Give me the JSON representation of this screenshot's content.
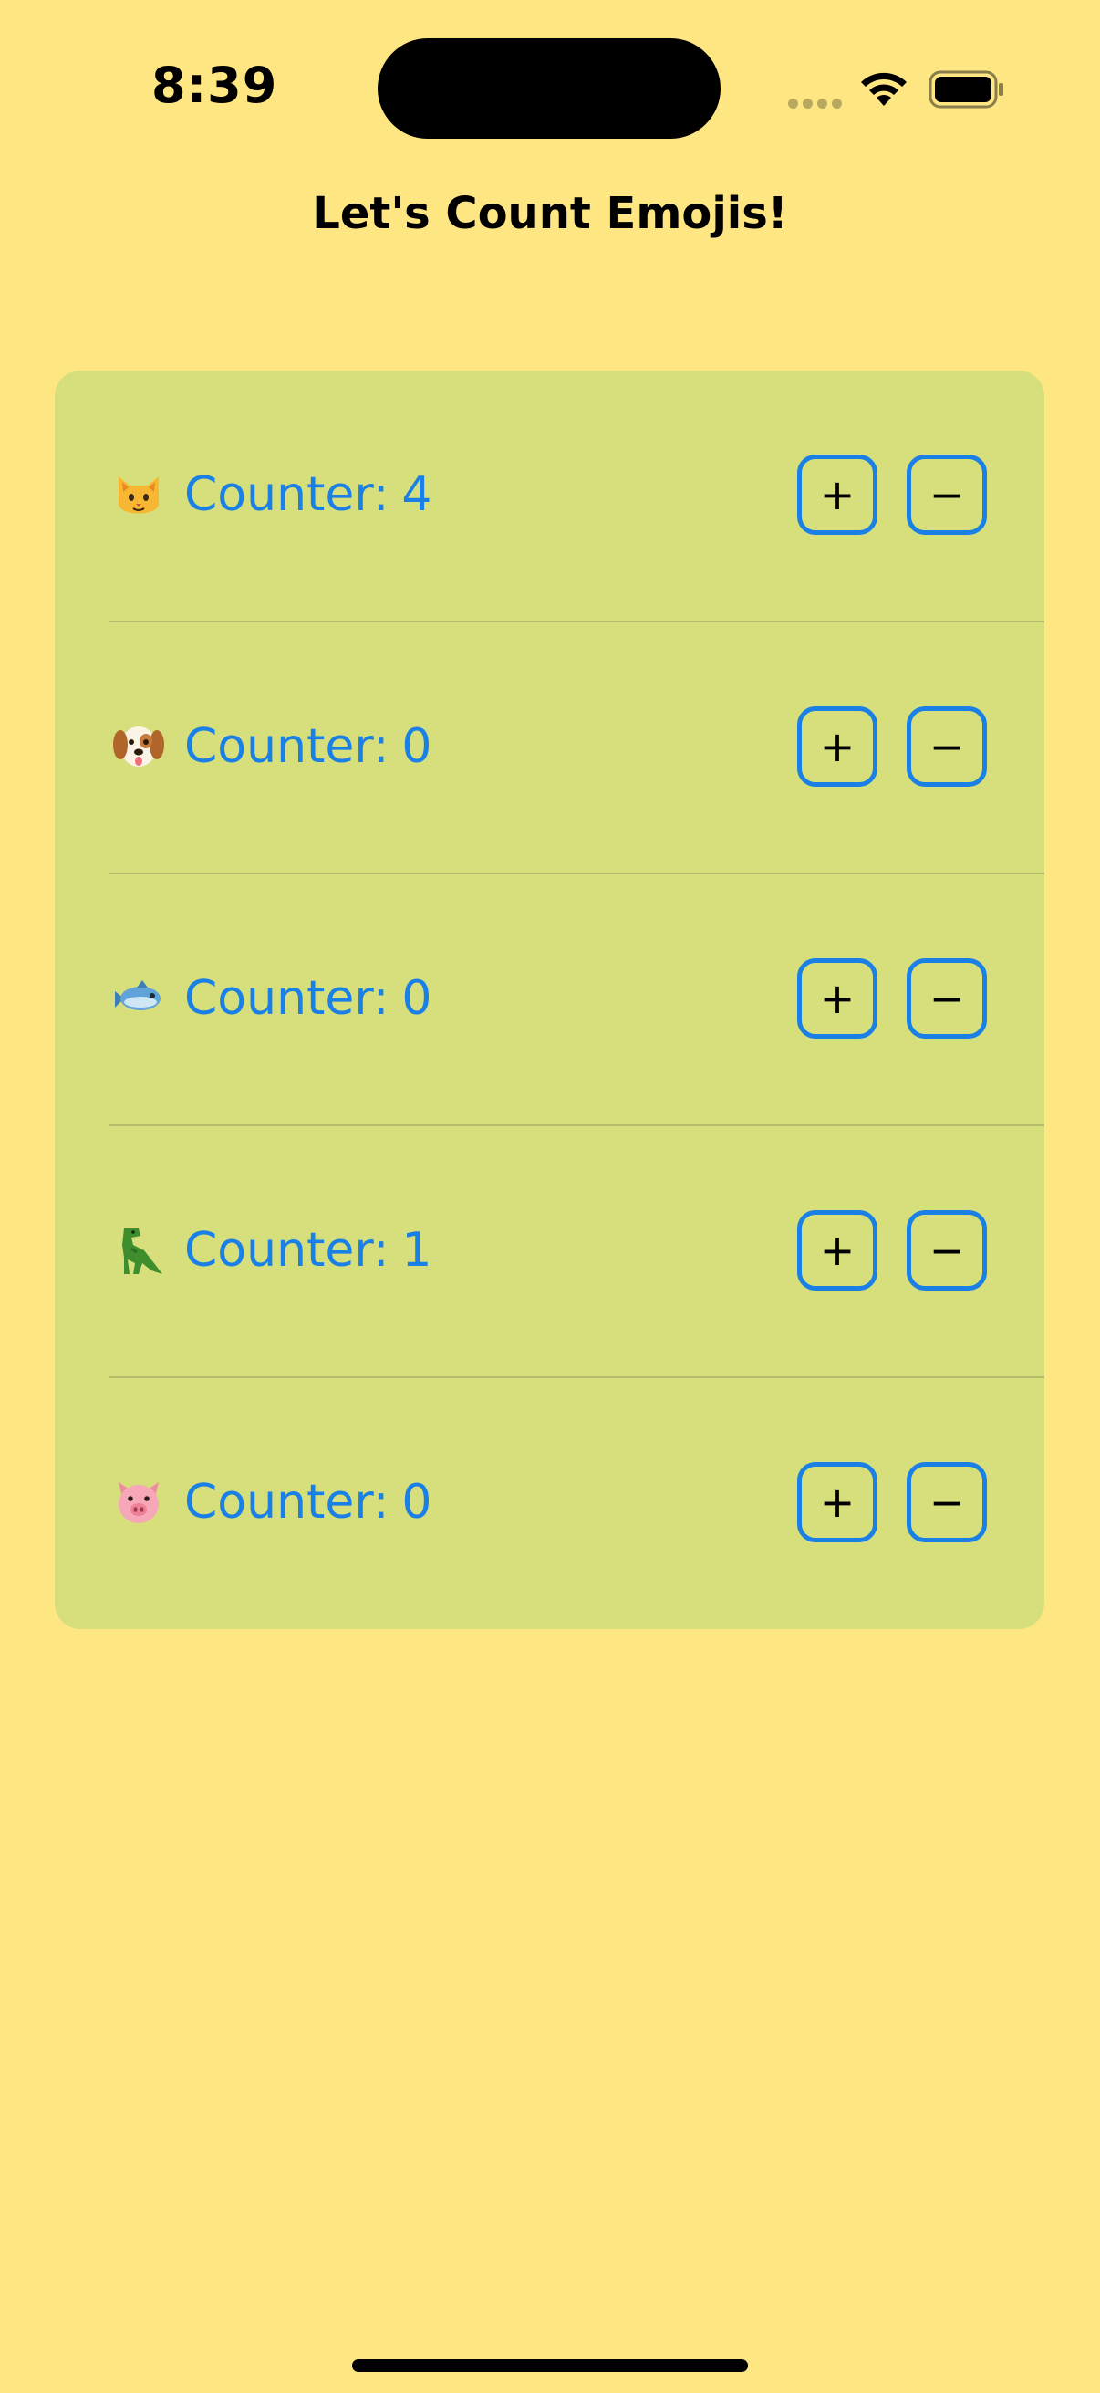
{
  "status_bar": {
    "time": "8:39"
  },
  "header": {
    "title": "Let's Count Emojis!"
  },
  "counters": [
    {
      "animal": "cat-face",
      "label": "Counter:",
      "value": "4",
      "plus_label": "+",
      "minus_label": "−"
    },
    {
      "animal": "dog-face",
      "label": "Counter:",
      "value": "0",
      "plus_label": "+",
      "minus_label": "−"
    },
    {
      "animal": "fish",
      "label": "Counter:",
      "value": "0",
      "plus_label": "+",
      "minus_label": "−"
    },
    {
      "animal": "t-rex",
      "label": "Counter:",
      "value": "1",
      "plus_label": "+",
      "minus_label": "−"
    },
    {
      "animal": "pig-face",
      "label": "Counter:",
      "value": "0",
      "plus_label": "+",
      "minus_label": "−"
    }
  ],
  "colors": {
    "background": "#FEE782",
    "card": "#D6DF7C",
    "accent": "#1A80E6"
  }
}
